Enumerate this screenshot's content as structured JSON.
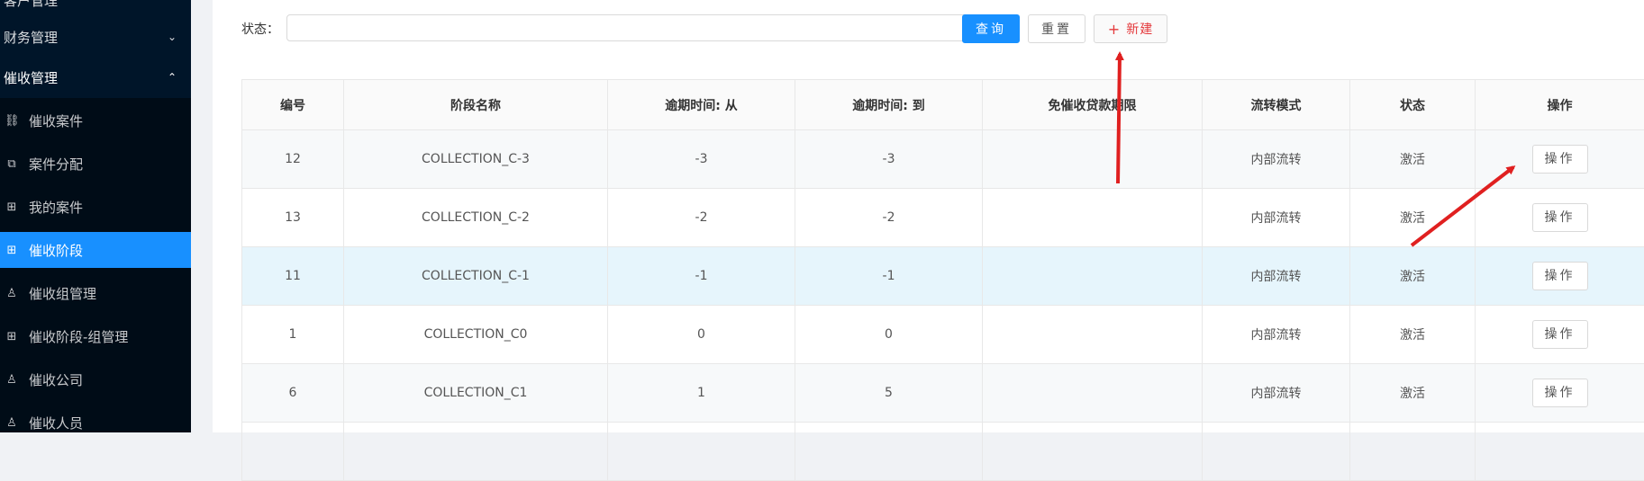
{
  "sidebar": {
    "items": [
      {
        "label": "客户管理",
        "icon": "none",
        "type": "top",
        "chevron": "",
        "active": false
      },
      {
        "label": "财务管理",
        "icon": "none",
        "type": "top",
        "chevron": "⌄",
        "active": false
      },
      {
        "label": "催收管理",
        "icon": "none",
        "type": "top",
        "chevron": "⌃",
        "active": false
      },
      {
        "label": "催收案件",
        "icon": "link-icon",
        "type": "sub",
        "active": false
      },
      {
        "label": "案件分配",
        "icon": "assign-icon",
        "type": "sub",
        "active": false
      },
      {
        "label": "我的案件",
        "icon": "gift-icon",
        "type": "sub",
        "active": false
      },
      {
        "label": "催收阶段",
        "icon": "gift-icon",
        "type": "sub",
        "active": true
      },
      {
        "label": "催收组管理",
        "icon": "user-icon",
        "type": "sub",
        "active": false
      },
      {
        "label": "催收阶段-组管理",
        "icon": "gift-icon",
        "type": "sub",
        "active": false
      },
      {
        "label": "催收公司",
        "icon": "user-icon",
        "type": "sub",
        "active": false
      },
      {
        "label": "催收人员",
        "icon": "user-icon",
        "type": "sub",
        "active": false
      }
    ]
  },
  "filter": {
    "status_label": "状态：",
    "status_value": ""
  },
  "buttons": {
    "query": "查询",
    "reset": "重置",
    "new": "新建",
    "new_icon": "+"
  },
  "table": {
    "columns": [
      "编号",
      "阶段名称",
      "逾期时间: 从",
      "逾期时间: 到",
      "免催收贷款期限",
      "流转模式",
      "状态",
      "操作"
    ],
    "rows": [
      {
        "id": "12",
        "name": "COLLECTION_C-3",
        "from": "-3",
        "to": "-3",
        "exempt": "",
        "mode": "内部流转",
        "status": "激活",
        "action": "操作"
      },
      {
        "id": "13",
        "name": "COLLECTION_C-2",
        "from": "-2",
        "to": "-2",
        "exempt": "",
        "mode": "内部流转",
        "status": "激活",
        "action": "操作"
      },
      {
        "id": "11",
        "name": "COLLECTION_C-1",
        "from": "-1",
        "to": "-1",
        "exempt": "",
        "mode": "内部流转",
        "status": "激活",
        "action": "操作"
      },
      {
        "id": "1",
        "name": "COLLECTION_C0",
        "from": "0",
        "to": "0",
        "exempt": "",
        "mode": "内部流转",
        "status": "激活",
        "action": "操作"
      },
      {
        "id": "6",
        "name": "COLLECTION_C1",
        "from": "1",
        "to": "5",
        "exempt": "",
        "mode": "内部流转",
        "status": "激活",
        "action": "操作"
      }
    ]
  },
  "colors": {
    "sidebar_bg": "#001529",
    "accent": "#1890ff",
    "annotation_arrow": "#e02020",
    "new_button_text": "#e4393c"
  }
}
